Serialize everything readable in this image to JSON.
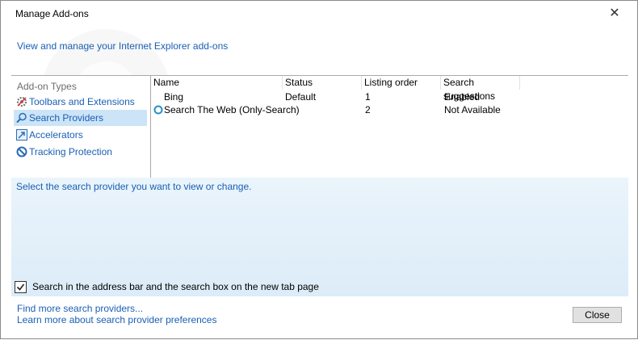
{
  "window": {
    "title": "Manage Add-ons",
    "close_glyph": "✕"
  },
  "header": {
    "link": "View and manage your Internet Explorer add-ons"
  },
  "sidebar": {
    "heading": "Add-on Types",
    "items": [
      {
        "label": "Toolbars and Extensions",
        "icon": "gear-icon"
      },
      {
        "label": "Search Providers",
        "icon": "search-icon",
        "selected": true
      },
      {
        "label": "Accelerators",
        "icon": "accelerator-icon"
      },
      {
        "label": "Tracking Protection",
        "icon": "tracking-protection-icon"
      }
    ]
  },
  "list": {
    "columns": [
      "Name",
      "Status",
      "Listing order",
      "Search suggestions"
    ],
    "rows": [
      {
        "name": "Bing",
        "status": "Default",
        "order": "1",
        "suggestions": "Enabled"
      },
      {
        "name": "Search The Web (Only-Search)",
        "status": "",
        "order": "2",
        "suggestions": "Not Available"
      }
    ]
  },
  "details": {
    "description": "Select the search provider you want to view or change.",
    "checkbox_label": "Search in the address bar and the search box on the new tab page",
    "checkbox_checked": true
  },
  "footer": {
    "link_find": "Find more search providers...",
    "link_learn": "Learn more about search provider preferences",
    "close_label": "Close"
  },
  "colors": {
    "link": "#1a5fb4",
    "selection": "#cce4f7",
    "panel": "#dcecf8"
  }
}
